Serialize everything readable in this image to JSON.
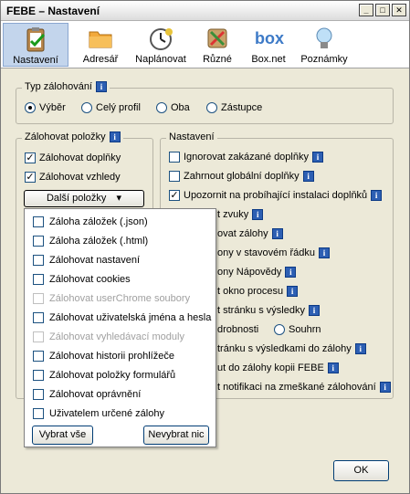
{
  "window": {
    "title": "FEBE – Nastavení"
  },
  "toolbar": {
    "items": [
      {
        "label": "Nastavení",
        "icon": "clipboard-check-icon",
        "active": true
      },
      {
        "label": "Adresář",
        "icon": "folder-icon"
      },
      {
        "label": "Naplánovat",
        "icon": "clock-icon"
      },
      {
        "label": "Různé",
        "icon": "tools-icon"
      },
      {
        "label": "Box.net",
        "icon": "box-logo"
      },
      {
        "label": "Poznámky",
        "icon": "lightbulb-icon"
      }
    ],
    "box_logo_text": "box"
  },
  "backup_type": {
    "legend": "Typ zálohování",
    "options": [
      "Výběr",
      "Celý profil",
      "Oba",
      "Zástupce"
    ],
    "selected": "Výběr"
  },
  "backup_items": {
    "legend": "Zálohovat položky",
    "addons": "Zálohovat doplňky",
    "themes": "Zálohovat vzhledy",
    "more_button": "Další položky",
    "more_arrow": "▾"
  },
  "popup": {
    "items": [
      {
        "label": "Záloha záložek (.json)",
        "checked": false,
        "disabled": false
      },
      {
        "label": "Záloha záložek (.html)",
        "checked": false,
        "disabled": false
      },
      {
        "label": "Zálohovat nastavení",
        "checked": false,
        "disabled": false
      },
      {
        "label": "Zálohovat cookies",
        "checked": false,
        "disabled": false
      },
      {
        "label": "Zálohovat userChrome soubory",
        "checked": false,
        "disabled": true
      },
      {
        "label": "Zálohovat uživatelská jména a hesla",
        "checked": false,
        "disabled": false
      },
      {
        "label": "Zálohovat vyhledávací moduly",
        "checked": false,
        "disabled": true
      },
      {
        "label": "Zálohovat historii prohlížeče",
        "checked": false,
        "disabled": false
      },
      {
        "label": "Zálohovat položky formulářů",
        "checked": false,
        "disabled": false
      },
      {
        "label": "Zálohovat oprávnění",
        "checked": false,
        "disabled": false
      },
      {
        "label": "Uživatelem určené zálohy",
        "checked": false,
        "disabled": false
      }
    ],
    "select_all": "Vybrat vše",
    "deselect_all": "Nevybrat nic"
  },
  "settings": {
    "legend": "Nastavení",
    "ignore_disabled": "Ignorovat zakázané doplňky",
    "include_global": "Zahrnout globální doplňky",
    "warn_install": "Upozornit na probíhající instalaci doplňků",
    "partial_rows": [
      "t zvuky",
      "ovat zálohy",
      "ony v stavovém řádku",
      "ony Nápovědy",
      "t okno procesu",
      "t stránku s výsledky",
      "drobnosti",
      "tránku s výsledkami do zálohy",
      "ut do zálohy kopii FEBE",
      "t notifikaci na zmeškané zálohování"
    ],
    "summary_option": "Souhrn"
  },
  "footer": {
    "ok": "OK"
  },
  "colors": {
    "accent": "#2d5fb3",
    "active_tab": "#c3d5ec",
    "window_bg": "#ece9d8"
  }
}
